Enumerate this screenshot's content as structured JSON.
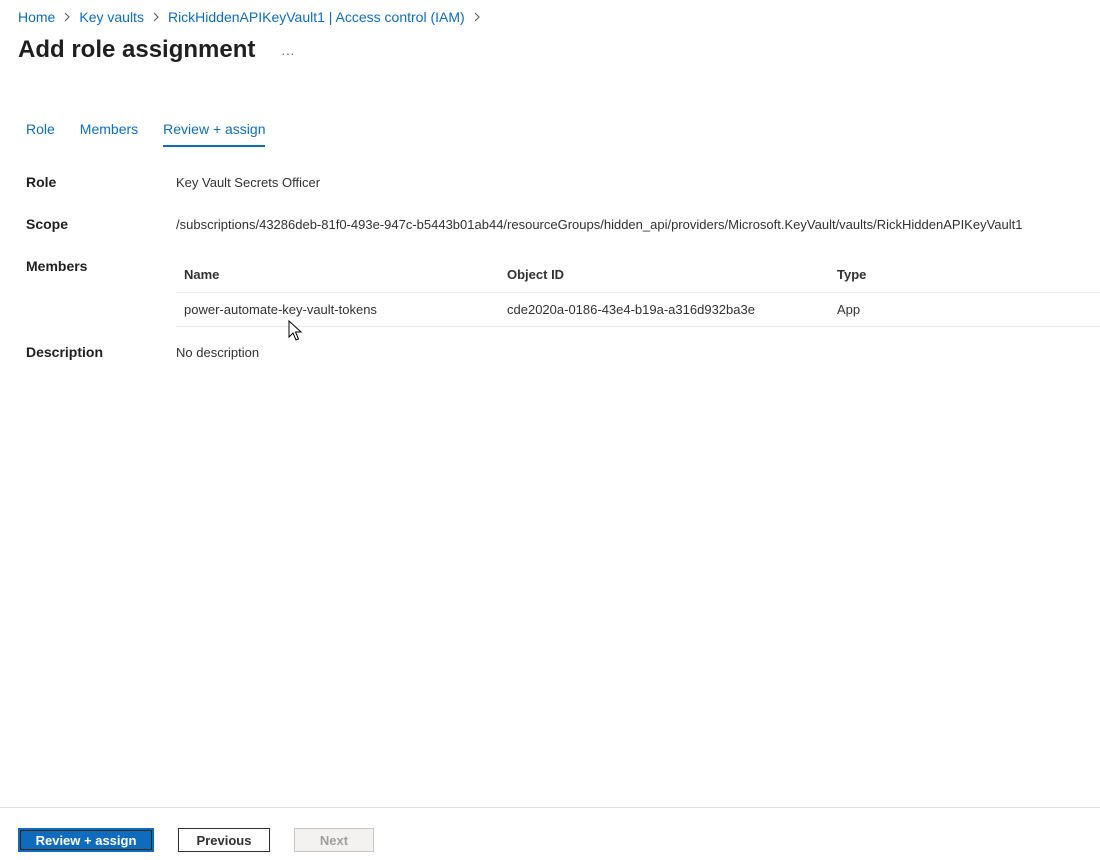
{
  "breadcrumb": {
    "items": [
      "Home",
      "Key vaults",
      "RickHiddenAPIKeyVault1 | Access control (IAM)"
    ]
  },
  "header": {
    "title": "Add role assignment",
    "more_label": "..."
  },
  "tabs": [
    {
      "label": "Role",
      "active": false
    },
    {
      "label": "Members",
      "active": false
    },
    {
      "label": "Review + assign",
      "active": true
    }
  ],
  "details": {
    "role_label": "Role",
    "role_value": "Key Vault Secrets Officer",
    "scope_label": "Scope",
    "scope_value": "/subscriptions/43286deb-81f0-493e-947c-b5443b01ab44/resourceGroups/hidden_api/providers/Microsoft.KeyVault/vaults/RickHiddenAPIKeyVault1",
    "members_label": "Members",
    "description_label": "Description",
    "description_value": "No description"
  },
  "members_table": {
    "columns": [
      "Name",
      "Object ID",
      "Type"
    ],
    "rows": [
      [
        "power-automate-key-vault-tokens",
        "cde2020a-0186-43e4-b19a-a316d932ba3e",
        "App"
      ]
    ]
  },
  "footer": {
    "primary_label": "Review + assign",
    "previous_label": "Previous",
    "next_label": "Next"
  },
  "colors": {
    "accent": "#0f6cbd",
    "text": "#323130",
    "divider": "#edebe9"
  }
}
